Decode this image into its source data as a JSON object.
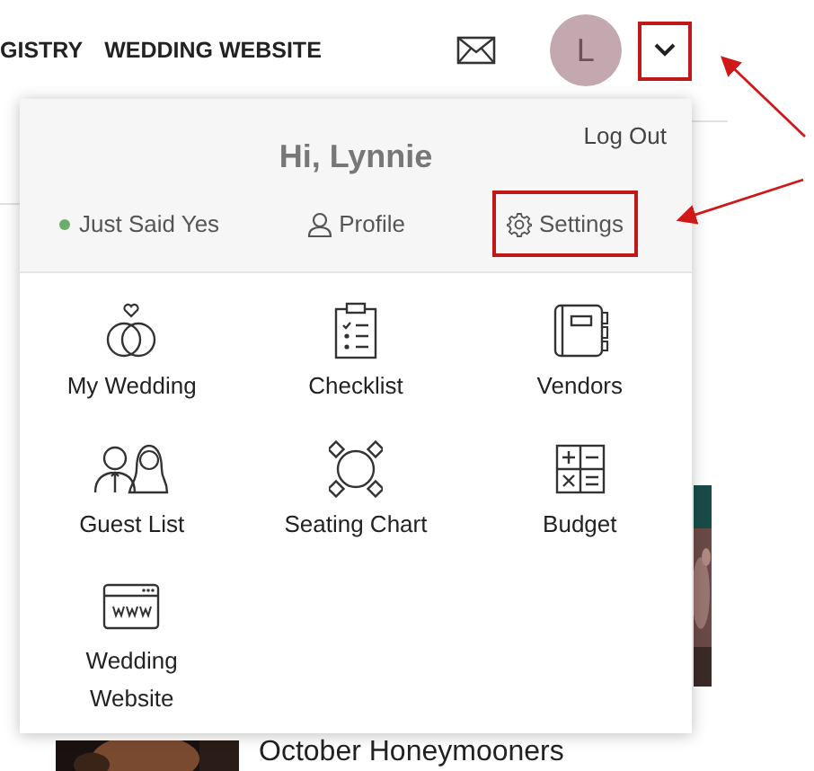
{
  "nav": {
    "items": [
      "GISTRY",
      "WEDDING WEBSITE"
    ],
    "avatar_initial": "L",
    "menu_toggle": {
      "highlighted": true
    }
  },
  "dropdown": {
    "log_out": "Log Out",
    "greeting": "Hi, Lynnie",
    "status": {
      "label": "Just Said Yes",
      "color": "#6aae6a"
    },
    "links": [
      {
        "kind": "profile",
        "label": "Profile",
        "highlighted": false
      },
      {
        "kind": "settings",
        "label": "Settings",
        "highlighted": true
      }
    ],
    "tools": [
      {
        "kind": "rings",
        "label": "My Wedding"
      },
      {
        "kind": "checklist",
        "label": "Checklist"
      },
      {
        "kind": "notebook",
        "label": "Vendors"
      },
      {
        "kind": "guests",
        "label": "Guest List"
      },
      {
        "kind": "table",
        "label": "Seating Chart"
      },
      {
        "kind": "calculator",
        "label": "Budget"
      },
      {
        "kind": "website",
        "label": "Wedding Website"
      }
    ]
  },
  "background": {
    "article_title": "October Honeymooners"
  }
}
